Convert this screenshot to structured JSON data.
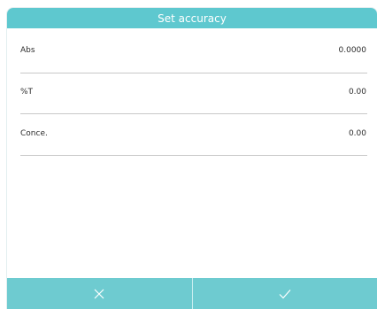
{
  "dialog": {
    "title": "Set accuracy",
    "rows": [
      {
        "label": "Abs",
        "value": "0.0000"
      },
      {
        "label": "%T",
        "value": "0.00"
      },
      {
        "label": "Conce.",
        "value": "0.00"
      }
    ]
  },
  "footer": {
    "cancel_icon": "close-icon",
    "confirm_icon": "check-icon"
  },
  "colors": {
    "accent": "#5ec8cf",
    "footer": "#6ecbd0",
    "divider": "#c8c8c8"
  }
}
